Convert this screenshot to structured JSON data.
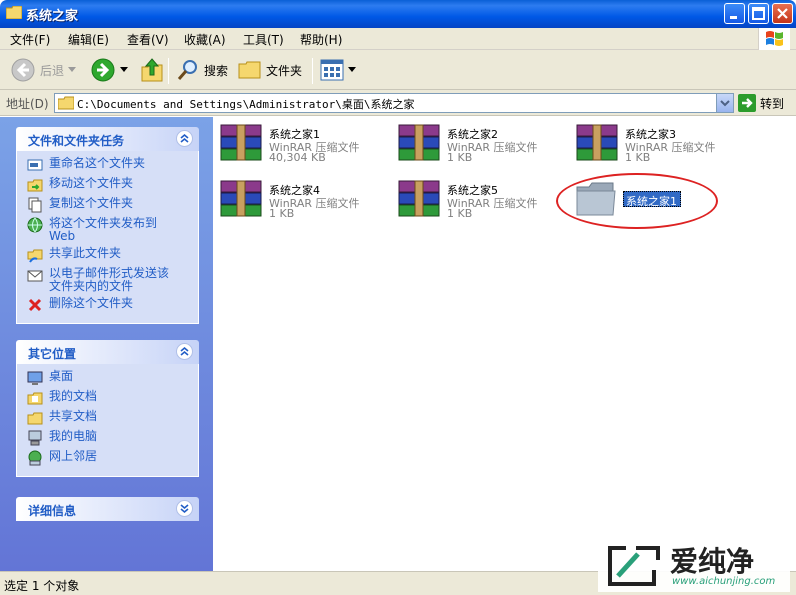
{
  "window": {
    "title": "系统之家"
  },
  "menu": [
    "文件(F)",
    "编辑(E)",
    "查看(V)",
    "收藏(A)",
    "工具(T)",
    "帮助(H)"
  ],
  "toolbar": {
    "back_label": "后退",
    "search_label": "搜索",
    "folders_label": "文件夹"
  },
  "address": {
    "label": "地址(D)",
    "path": "C:\\Documents and Settings\\Administrator\\桌面\\系统之家",
    "go_label": "转到"
  },
  "left_pane": {
    "tasks": {
      "title": "文件和文件夹任务",
      "items": [
        "重命名这个文件夹",
        "移动这个文件夹",
        "复制这个文件夹",
        "将这个文件夹发布到\nWeb",
        "共享此文件夹",
        "以电子邮件形式发送该\n文件夹内的文件",
        "删除这个文件夹"
      ]
    },
    "other_places": {
      "title": "其它位置",
      "items": [
        "桌面",
        "我的文档",
        "共享文档",
        "我的电脑",
        "网上邻居"
      ]
    },
    "details": {
      "title": "详细信息"
    }
  },
  "files": [
    {
      "name": "系统之家1",
      "type": "WinRAR 压缩文件",
      "size": "40,304 KB"
    },
    {
      "name": "系统之家2",
      "type": "WinRAR 压缩文件",
      "size": "1 KB"
    },
    {
      "name": "系统之家3",
      "type": "WinRAR 压缩文件",
      "size": "1 KB"
    },
    {
      "name": "系统之家4",
      "type": "WinRAR 压缩文件",
      "size": "1 KB"
    },
    {
      "name": "系统之家5",
      "type": "WinRAR 压缩文件",
      "size": "1 KB"
    }
  ],
  "new_folder": {
    "name": "系统之家1"
  },
  "status": {
    "text": "选定 1 个对象"
  },
  "watermark": {
    "brand": "爱纯净",
    "url": "www.aichunjing.com"
  },
  "colors": {
    "titlebar": "#0058e6",
    "task_link": "#215dc6",
    "selection": "#316ac5",
    "highlight_ring": "#dd2222"
  }
}
